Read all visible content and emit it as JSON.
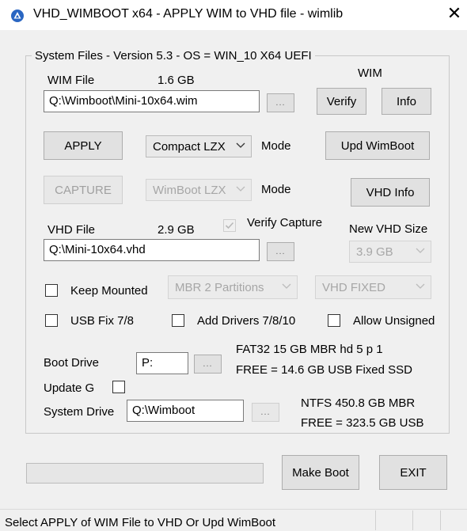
{
  "window": {
    "title": "VHD_WIMBOOT x64 - APPLY WIM to VHD file - wimlib",
    "close_glyph": "✕",
    "icon": "wimlib-app-icon"
  },
  "group": {
    "legend": "System Files - Version 5.3  -  OS = WIN_10 X64  UEFI"
  },
  "wim": {
    "header": "WIM",
    "file_label": "WIM File",
    "size": "1.6 GB",
    "path": "Q:\\Wimboot\\Mini-10x64.wim",
    "browse_label": "...",
    "verify_label": "Verify",
    "info_label": "Info"
  },
  "apply": {
    "apply_label": "APPLY",
    "compression": "Compact LZX",
    "mode_label": "Mode",
    "upd_wimboot_label": "Upd WimBoot"
  },
  "capture": {
    "capture_label": "CAPTURE",
    "compression": "WimBoot LZX",
    "mode_label": "Mode",
    "vhd_info_label": "VHD Info"
  },
  "vhd": {
    "file_label": "VHD File",
    "size": "2.9 GB",
    "verify_capture_label": "Verify Capture",
    "verify_capture_checked": true,
    "new_size_label": "New VHD Size",
    "new_size_value": "3.9 GB",
    "path": "Q:\\Mini-10x64.vhd",
    "browse_label": "..."
  },
  "options": {
    "keep_mounted_label": "Keep Mounted",
    "keep_mounted_checked": false,
    "partition_scheme": "MBR  2  Partitions",
    "vhd_type": "VHD   FIXED",
    "usb_fix_label": "USB Fix 7/8",
    "usb_fix_checked": false,
    "add_drivers_label": "Add Drivers 7/8/10",
    "add_drivers_checked": false,
    "allow_unsigned_label": "Allow Unsigned",
    "allow_unsigned_checked": false
  },
  "boot": {
    "boot_drive_label": "Boot  Drive",
    "boot_drive_value": "P:",
    "browse_label": "...",
    "info_line1": "FAT32    15 GB     MBR  hd 5  p 1",
    "info_line2": "FREE  = 14.6 GB   USB  Fixed  SSD",
    "update_g_label": "Update G",
    "update_g_checked": false
  },
  "system": {
    "system_drive_label": "System Drive",
    "system_drive_value": "Q:\\Wimboot",
    "browse_label": "...",
    "info_line1": "NTFS    450.8 GB  MBR",
    "info_line2": "FREE  = 323.5 GB  USB"
  },
  "actions": {
    "make_boot_label": "Make Boot",
    "exit_label": "EXIT",
    "progress": 0
  },
  "status": {
    "text": "Select APPLY of WIM File to VHD Or Upd WimBoot"
  },
  "colors": {
    "window_bg": "#f0f0f0",
    "titlebar_bg": "#ffffff",
    "app_icon_blue": "#2a66c2"
  }
}
